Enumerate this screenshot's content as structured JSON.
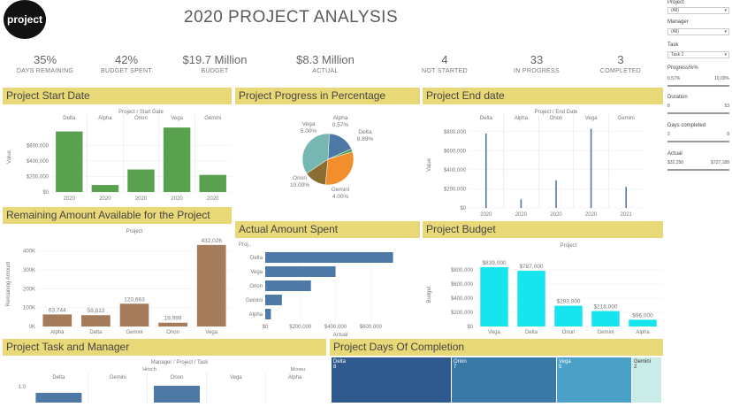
{
  "logo": "project",
  "title": "2020 PROJECT ANALYSIS",
  "kpis": [
    {
      "value": "35%",
      "label": "DAYS REMAINING"
    },
    {
      "value": "42%",
      "label": "BUDGET SPENT"
    },
    {
      "value": "$19.7 Million",
      "label": "BUDGET"
    },
    {
      "value": "$8.3 Million",
      "label": "ACTUAL"
    },
    {
      "value": "4",
      "label": "NOT STARTED"
    },
    {
      "value": "33",
      "label": "IN PROGRESS"
    },
    {
      "value": "3",
      "label": "COMPLETED"
    }
  ],
  "panels": {
    "start": "Project Start Date",
    "progress": "Project Progress in Percentage",
    "end": "Project End date",
    "remaining": "Remaining Amount Available for the Project",
    "actual": "Actual Amount Spent",
    "budget": "Project Budget",
    "task": "Project Task and Manager",
    "days": "Project Days Of Completion"
  },
  "sidebar": {
    "project_label": "Project",
    "project_value": "(All)",
    "manager_label": "Manager",
    "manager_value": "(All)",
    "task_label": "Task",
    "task_value": "Task 2",
    "progress_label": "Progress%%",
    "progress_min": "0.57%",
    "progress_max": "10.00%",
    "duration_label": "Duration",
    "duration_min": "8",
    "duration_max": "53",
    "days_label": "Days completed",
    "days_min": "2",
    "days_max": "8",
    "actual_label": "Actual",
    "actual_min": "$32,250",
    "actual_max": "$727,188"
  },
  "chart_data": [
    {
      "type": "bar",
      "title": "Project / Start Date",
      "ylabel": "Value",
      "categories": [
        "Delta",
        "Alpha",
        "Orion",
        "Vega",
        "Gemini"
      ],
      "tick_labels": [
        "2020",
        "2020",
        "2020",
        "2020",
        "2020"
      ],
      "values": [
        780000,
        90000,
        290000,
        830000,
        220000
      ],
      "ylim": [
        0,
        900000
      ],
      "yticks": [
        0,
        200000,
        400000,
        600000
      ],
      "ytick_labels": [
        "$0",
        "$200,000",
        "$400,000",
        "$600,000"
      ],
      "color": "#59a14f"
    },
    {
      "type": "pie",
      "series": [
        {
          "name": "Vega",
          "value": 5.0,
          "label": "5.00%",
          "color": "#4e79a7"
        },
        {
          "name": "Alpha",
          "value": 0.57,
          "label": "0.57%",
          "color": "#59a14f"
        },
        {
          "name": "Delta",
          "value": 8.89,
          "label": "8.89%",
          "color": "#f28e2b"
        },
        {
          "name": "Gemini",
          "value": 4.0,
          "label": "4.00%",
          "color": "#8c6d31"
        },
        {
          "name": "Orion",
          "value": 10.0,
          "label": "10.00%",
          "color": "#76b7b2"
        }
      ]
    },
    {
      "type": "bar",
      "title": "Project / End Date",
      "ylabel": "Value",
      "categories": [
        "Delta",
        "Alpha",
        "Orion",
        "Vega",
        "Gemini"
      ],
      "tick_labels": [
        "2020",
        "2020",
        "2020",
        "2020",
        "2021"
      ],
      "values": [
        780000,
        90000,
        290000,
        830000,
        220000
      ],
      "ylim": [
        0,
        900000
      ],
      "yticks": [
        0,
        200000,
        400000,
        600000,
        800000
      ],
      "ytick_labels": [
        "$0",
        "$200,000",
        "$400,000",
        "$600,000",
        "$800,000"
      ],
      "color": "#4e79a7"
    },
    {
      "type": "bar",
      "title": "Project",
      "ylabel": "Remaining Amount",
      "categories": [
        "Alpha",
        "Delta",
        "Gemini",
        "Orion",
        "Vega"
      ],
      "values": [
        63744,
        59812,
        120663,
        19999,
        432026
      ],
      "labels": [
        "63,744",
        "59,812",
        "120,663",
        "19,999",
        "432,026"
      ],
      "ylim": [
        0,
        450000
      ],
      "yticks": [
        0,
        100000,
        200000,
        300000,
        400000
      ],
      "ytick_labels": [
        "0K",
        "100K",
        "200K",
        "300K",
        "400K"
      ],
      "color": "#a47c5b"
    },
    {
      "type": "bar",
      "orientation": "horizontal",
      "ylabel": "Proj..",
      "xlabel": "Actual",
      "categories": [
        "Delta",
        "Vega",
        "Orion",
        "Gemini",
        "Alpha"
      ],
      "values": [
        727188,
        400000,
        260000,
        95000,
        32250
      ],
      "xlim": [
        0,
        860000
      ],
      "xticks": [
        0,
        200000,
        400000,
        600000
      ],
      "xtick_labels": [
        "$0",
        "$200,000",
        "$400,000",
        "$600,000"
      ],
      "color": "#4e79a7"
    },
    {
      "type": "bar",
      "title": "Project",
      "ylabel": "Budget",
      "categories": [
        "Vega",
        "Delta",
        "Orion",
        "Gemini",
        "Alpha"
      ],
      "values": [
        839000,
        787000,
        293000,
        218000,
        96000
      ],
      "labels": [
        "$839,000",
        "$787,000",
        "$293,000",
        "$218,000",
        "$96,000"
      ],
      "ylim": [
        0,
        900000
      ],
      "yticks": [
        0,
        200000,
        400000,
        600000,
        800000
      ],
      "ytick_labels": [
        "$0",
        "$200,000",
        "$400,000",
        "$600,000",
        "$800,000"
      ],
      "color": "#17e5ee"
    },
    {
      "type": "bar",
      "title": "Manager / Project / Task",
      "managers": [
        "Hrisch",
        "Mcneu"
      ],
      "categories": [
        "Delta",
        "Gemini",
        "Orion",
        "Vega",
        "Alpha"
      ],
      "values": [
        1,
        0,
        1,
        0,
        0
      ],
      "ytick_labels": [
        "1.0"
      ],
      "color": "#4e79a7"
    },
    {
      "type": "treemap",
      "series": [
        {
          "name": "Delta",
          "value": 8,
          "color": "#2e5a8e"
        },
        {
          "name": "Orion",
          "value": 7,
          "color": "#3a78a8"
        },
        {
          "name": "Vega",
          "value": 5,
          "color": "#4aa0c6"
        },
        {
          "name": "Gemini",
          "value": 2,
          "color": "#c9ece8",
          "text": "#333"
        }
      ]
    }
  ]
}
